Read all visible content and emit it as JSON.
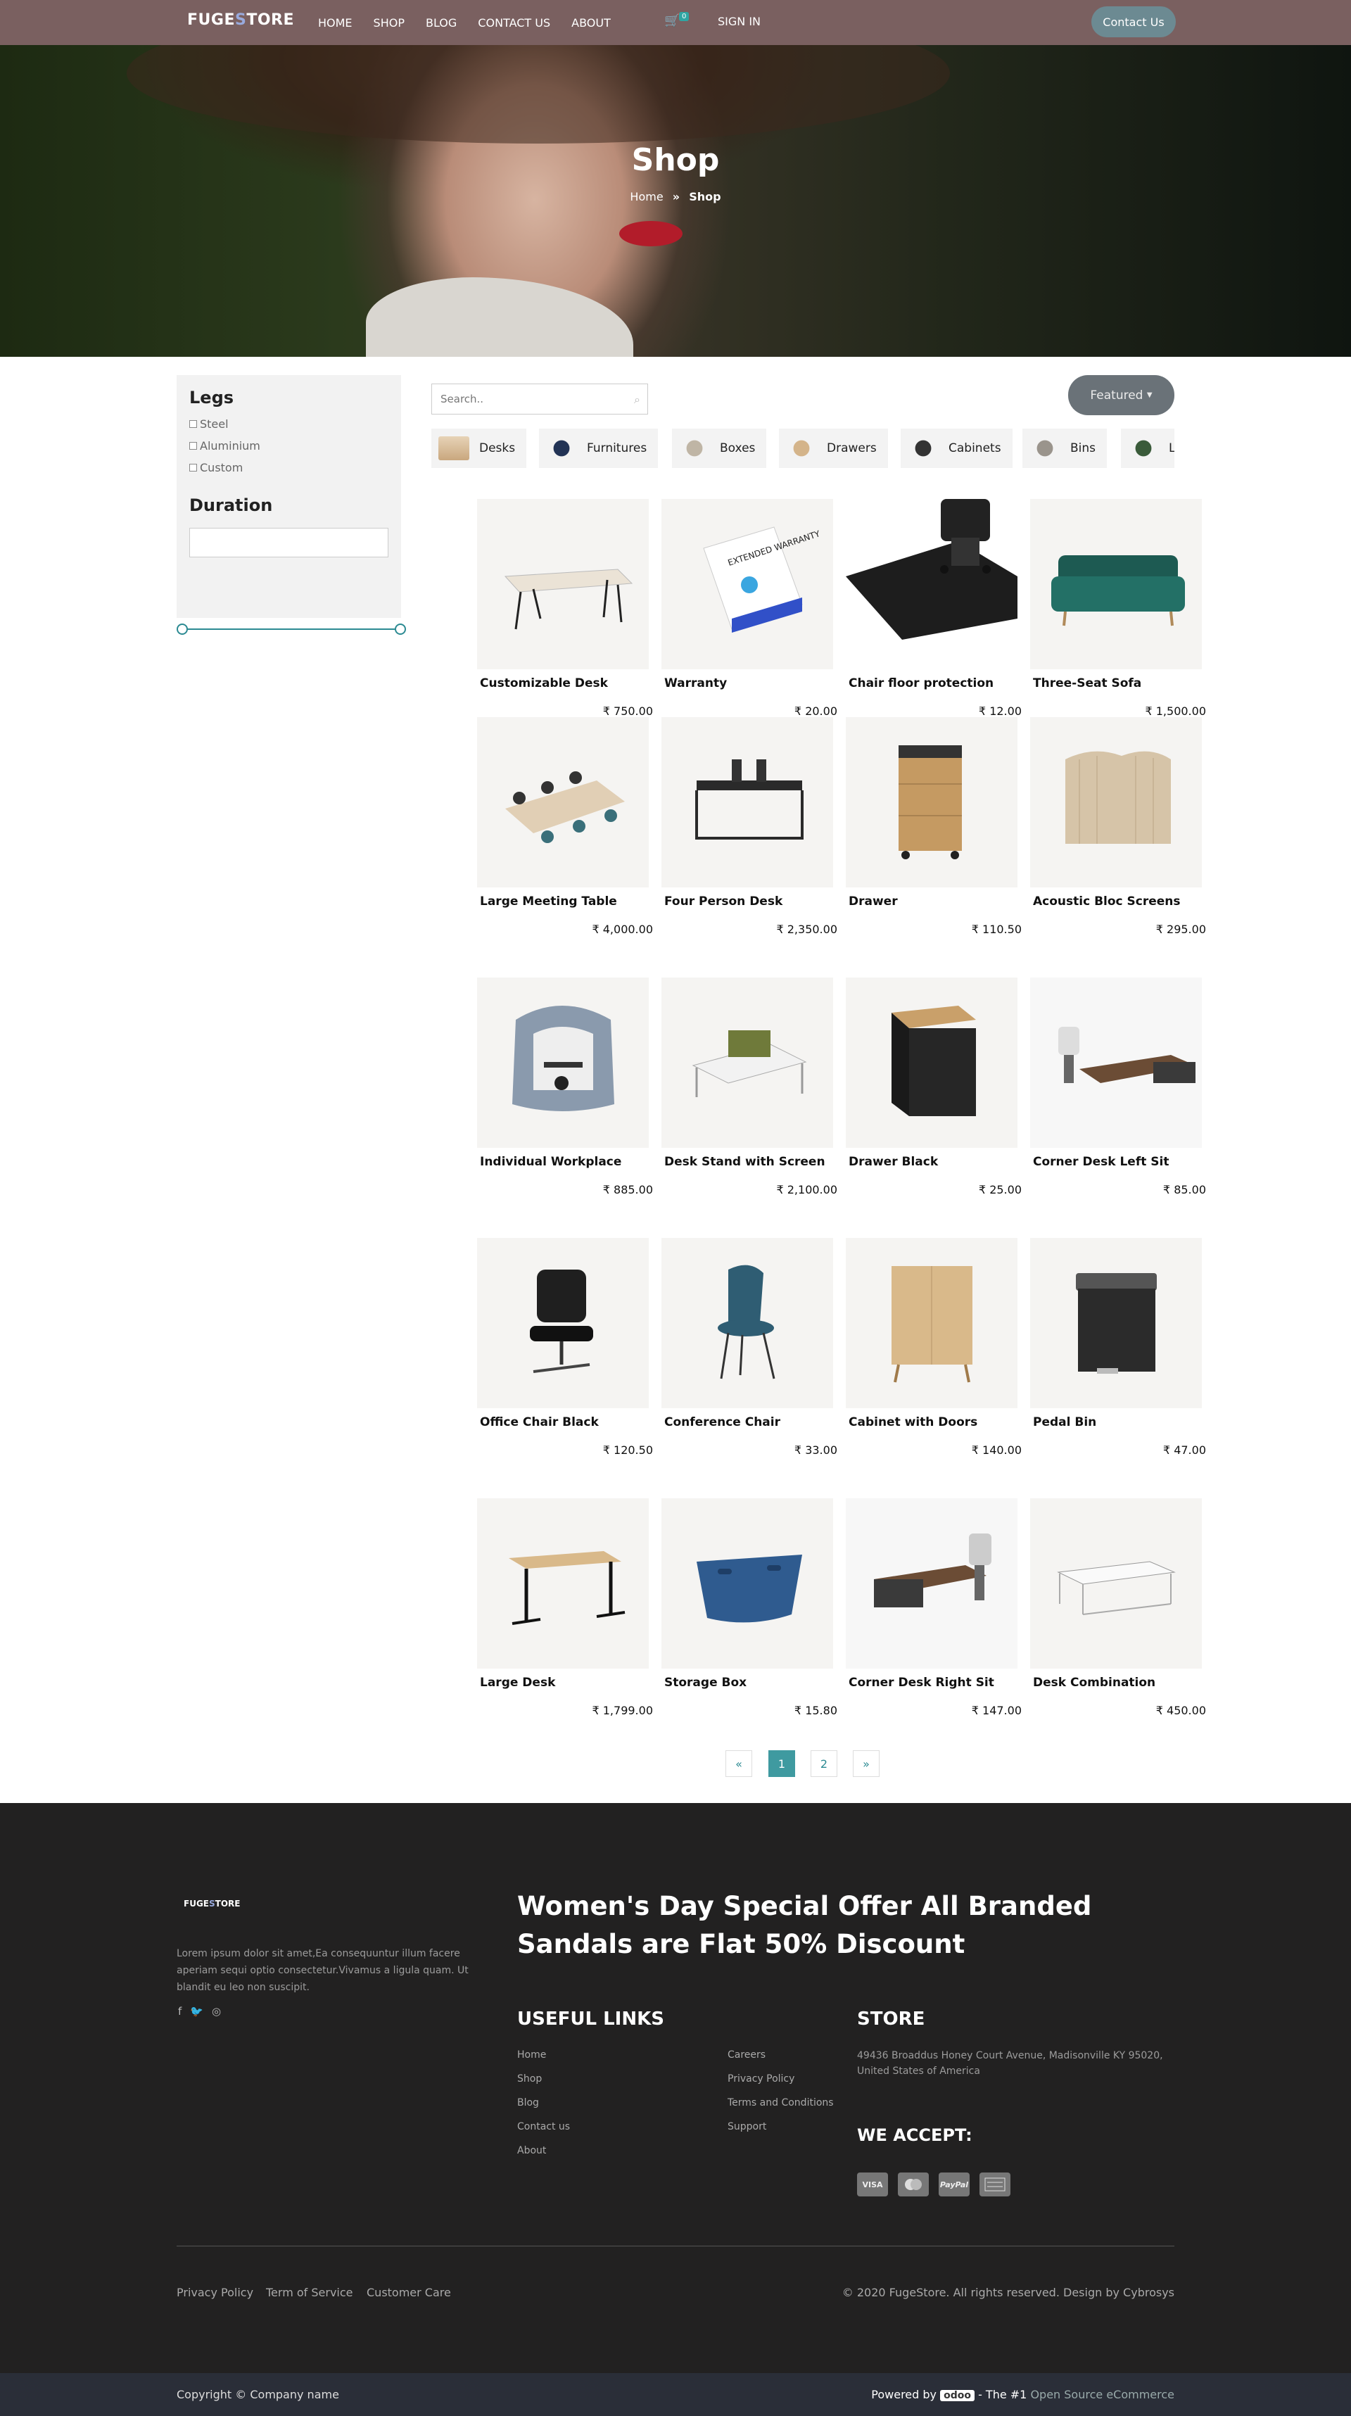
{
  "nav": {
    "logo_left": "FUGE",
    "logo_mid": "S",
    "logo_right": "TORE",
    "items": [
      "HOME",
      "SHOP",
      "BLOG",
      "CONTACT US",
      "ABOUT"
    ],
    "cart_count": "0",
    "sign_in": "SIGN IN",
    "contact_button": "Contact Us"
  },
  "hero": {
    "title": "Shop",
    "breadcrumb_home": "Home",
    "breadcrumb_sep": "»",
    "breadcrumb_current": "Shop"
  },
  "filters": {
    "legs_title": "Legs",
    "legs_options": [
      "Steel",
      "Aluminium",
      "Custom"
    ],
    "duration_title": "Duration"
  },
  "search": {
    "placeholder": "Search.."
  },
  "sort": {
    "label": "Featured"
  },
  "categories": [
    "Desks",
    "Furnitures",
    "Boxes",
    "Drawers",
    "Cabinets",
    "Bins",
    "L"
  ],
  "products": [
    {
      "name": "Customizable Desk",
      "price": "₹ 750.00"
    },
    {
      "name": "Warranty",
      "price": "₹ 20.00"
    },
    {
      "name": "Chair floor protection",
      "price": "₹ 12.00"
    },
    {
      "name": "Three-Seat Sofa",
      "price": "₹ 1,500.00"
    },
    {
      "name": "Large Meeting Table",
      "price": "₹ 4,000.00"
    },
    {
      "name": "Four Person Desk",
      "price": "₹ 2,350.00"
    },
    {
      "name": "Drawer",
      "price": "₹ 110.50"
    },
    {
      "name": "Acoustic Bloc Screens",
      "price": "₹ 295.00"
    },
    {
      "name": "Individual Workplace",
      "price": "₹ 885.00"
    },
    {
      "name": "Desk Stand with Screen",
      "price": "₹ 2,100.00"
    },
    {
      "name": "Drawer Black",
      "price": "₹ 25.00"
    },
    {
      "name": "Corner Desk Left Sit",
      "price": "₹ 85.00"
    },
    {
      "name": "Office Chair Black",
      "price": "₹ 120.50"
    },
    {
      "name": "Conference Chair",
      "price": "₹ 33.00"
    },
    {
      "name": "Cabinet with Doors",
      "price": "₹ 140.00"
    },
    {
      "name": "Pedal Bin",
      "price": "₹ 47.00"
    },
    {
      "name": "Large Desk",
      "price": "₹ 1,799.00"
    },
    {
      "name": "Storage Box",
      "price": "₹ 15.80"
    },
    {
      "name": "Corner Desk Right Sit",
      "price": "₹ 147.00"
    },
    {
      "name": "Desk Combination",
      "price": "₹ 450.00"
    }
  ],
  "warranty_box_text": "EXTENDED WARRANTY",
  "pagination": {
    "prev": "«",
    "pages": [
      "1",
      "2"
    ],
    "next": "»",
    "current": "1"
  },
  "footer": {
    "logo_left": "FUGE",
    "logo_mid": "S",
    "logo_right": "TORE",
    "about_text": "Lorem ipsum dolor sit amet,Ea consequuntur illum facere aperiam sequi optio consectetur.Vivamus a ligula quam. Ut blandit eu leo non suscipit.",
    "promo": "Women's Day Special Offer All Branded Sandals are Flat 50% Discount",
    "useful_links_title": "USEFUL LINKS",
    "links_col1": [
      "Home",
      "Shop",
      "Blog",
      "Contact us",
      "About"
    ],
    "links_col2": [
      "Careers",
      "Privacy Policy",
      "Terms and Conditions",
      "Support"
    ],
    "store_title": "STORE",
    "store_address": "49436 Broaddus Honey Court Avenue, Madisonville KY 95020, United States of America",
    "accept_title": "WE ACCEPT:",
    "payment_labels": [
      "VISA",
      "",
      "PayPal",
      ""
    ],
    "bottom_links": [
      "Privacy Policy",
      "Term of Service",
      "Customer Care"
    ],
    "copyright": "© 2020 FugeStore. All rights reserved. Design by Cybrosys"
  },
  "bottom_bar": {
    "copyright": "Copyright © Company name",
    "powered_by": "Powered by",
    "odoo": "odoo",
    "the_no1": " - The #1 ",
    "open_source": "Open Source eCommerce"
  },
  "colors": {
    "nav_bg": "#7a6060",
    "accent": "#3f9aa0",
    "footer_bg": "#222121",
    "bottom_bg": "#2a2e38"
  }
}
